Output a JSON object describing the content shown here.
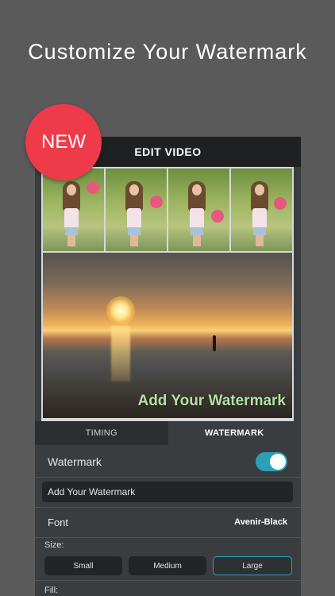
{
  "headline": "Customize Your Watermark",
  "badge": "NEW",
  "topbar": {
    "title": "EDIT VIDEO"
  },
  "preview": {
    "watermark_text": "Add Your Watermark"
  },
  "tabs": [
    {
      "label": "TIMING",
      "active": false
    },
    {
      "label": "WATERMARK",
      "active": true
    }
  ],
  "settings": {
    "watermark_label": "Watermark",
    "watermark_enabled": true,
    "watermark_input_value": "Add Your Watermark",
    "font_label": "Font",
    "font_value": "Avenir-Black",
    "size_label": "Size:",
    "size_options": [
      "Small",
      "Medium",
      "Large"
    ],
    "size_selected": "Large",
    "fill_label": "Fill:"
  },
  "colors": {
    "background": "#5a5a5a",
    "badge": "#ef3a49",
    "accent": "#2a9fb6",
    "watermark_text": "#b4e0a6"
  },
  "icons": [
    "toggle-switch"
  ]
}
